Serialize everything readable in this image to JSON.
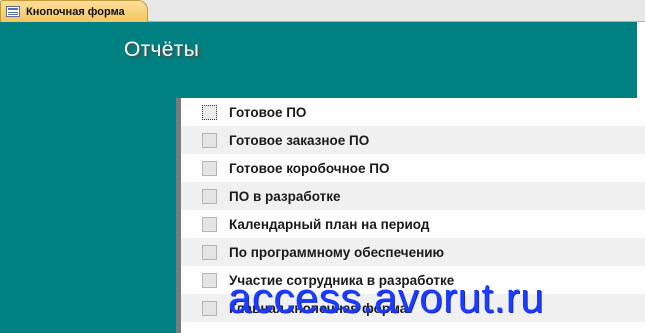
{
  "tab": {
    "label": "Кнопочная форма",
    "icon": "form-icon"
  },
  "header": {
    "title": "Отчёты"
  },
  "colors": {
    "header_bg": "#008080",
    "watermark": "#1b3cff",
    "tab_bg": "#f3c560"
  },
  "items": [
    {
      "label": "Готовое ПО"
    },
    {
      "label": "Готовое заказное ПО"
    },
    {
      "label": "Готовое коробочное ПО"
    },
    {
      "label": "ПО в разработке"
    },
    {
      "label": "Календарный план на период"
    },
    {
      "label": "По программному обеспечению"
    },
    {
      "label": "Участие сотрудника в разработке"
    },
    {
      "label": "Главная кнопочная форма"
    }
  ],
  "watermark": {
    "text": "access.avorut.ru"
  }
}
